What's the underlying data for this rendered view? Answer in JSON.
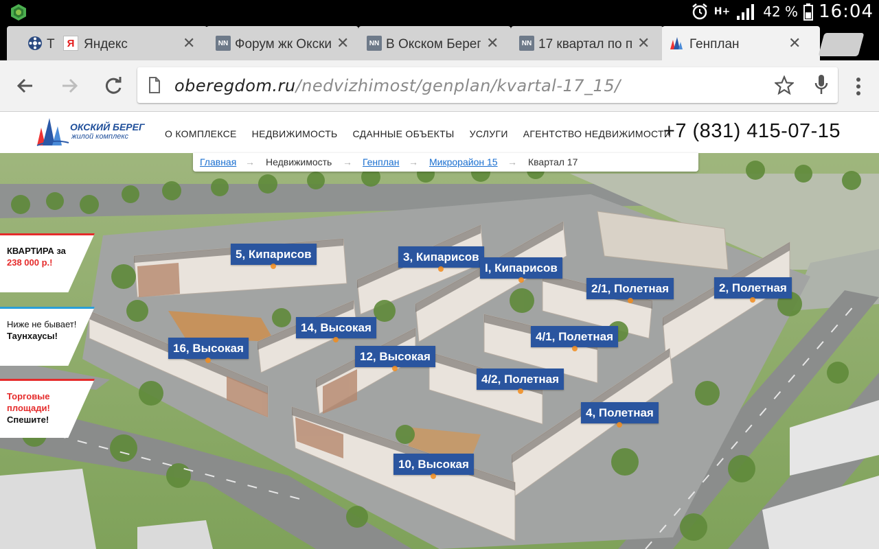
{
  "status_bar": {
    "network": "H+",
    "battery": "42 %",
    "time": "16:04"
  },
  "tabs": [
    {
      "title": "Т",
      "favicon": "film-reel-icon",
      "active": false
    },
    {
      "title": "Яндекс",
      "favicon": "yandex-icon",
      "active": false
    },
    {
      "title": "Форум жк Окски",
      "favicon": "nn-icon",
      "active": false
    },
    {
      "title": "В Окском Берег",
      "favicon": "nn-icon",
      "active": false
    },
    {
      "title": "17 квартал по п",
      "favicon": "nn-icon",
      "active": false
    },
    {
      "title": "Генплан",
      "favicon": "okskiy-bereg-icon",
      "active": true
    }
  ],
  "favicon_text": {
    "nn": "NN",
    "yandex": "Я"
  },
  "address_bar": {
    "host": "oberegdom.ru",
    "path": "/nedvizhimost/genplan/kvartal-17_15/"
  },
  "site": {
    "logo_title": "ОКСКИЙ БЕРЕГ",
    "logo_subtitle": "жилой комплекс",
    "nav": [
      "О КОМПЛЕКСЕ",
      "НЕДВИЖИМОСТЬ",
      "СДАННЫЕ ОБЪЕКТЫ",
      "УСЛУГИ",
      "АГЕНТСТВО НЕДВИЖИМОСТИ"
    ],
    "phone": "+7 (831) 415-07-15"
  },
  "breadcrumb": {
    "home": "Главная",
    "realty": "Недвижимость",
    "genplan": "Генплан",
    "district": "Микрорайон 15",
    "current": "Квартал 17",
    "separator": "→"
  },
  "buildings": [
    "5, Кипарисов",
    "3, Кипарисов",
    "I, Кипарисов",
    "2/1, Полетная",
    "2, Полетная",
    "14, Высокая",
    "4/1, Полетная",
    "16, Высокая",
    "12, Высокая",
    "4/2, Полетная",
    "4, Полетная",
    "10, Высокая"
  ],
  "promos": {
    "apartment_line1": "КВАРТИРА за",
    "apartment_line2": "238 000 р.!",
    "townhouse_line1": "Ниже не бывает!",
    "townhouse_line2": "Таунхаусы!",
    "retail_line1": "Торговые",
    "retail_line2": "площади!",
    "retail_line3": "Спешите!"
  },
  "colors": {
    "label_bg": "#2a559f",
    "promo_red": "#e52b2b",
    "link": "#1a6fd0"
  }
}
